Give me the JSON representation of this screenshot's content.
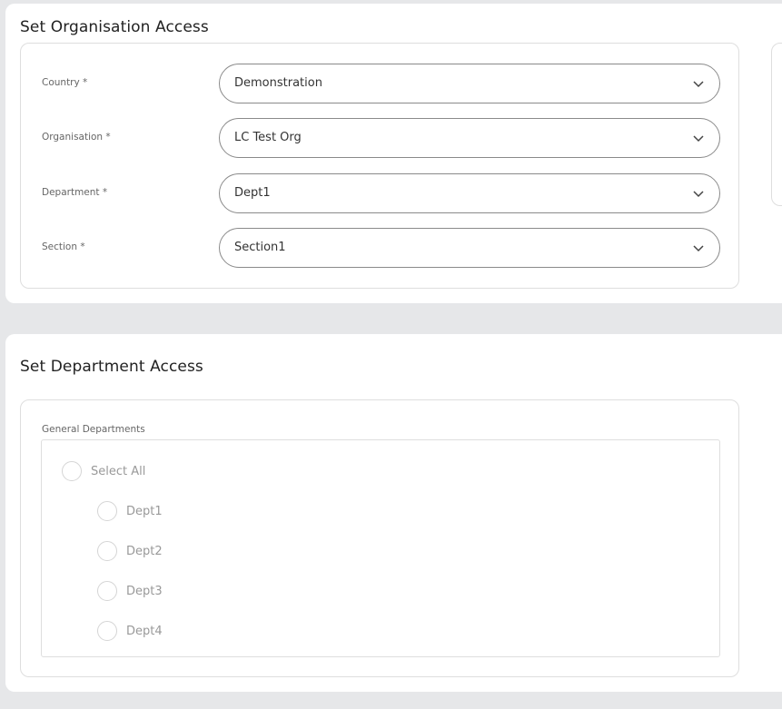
{
  "org_access": {
    "title": "Set Organisation Access",
    "fields": [
      {
        "label": "Country *",
        "value": "Demonstration"
      },
      {
        "label": "Organisation *",
        "value": "LC Test Org"
      },
      {
        "label": "Department *",
        "value": "Dept1"
      },
      {
        "label": "Section *",
        "value": "Section1"
      }
    ]
  },
  "dept_access": {
    "title": "Set Department Access",
    "group_label": "General Departments",
    "select_all": "Select All",
    "departments": [
      "Dept1",
      "Dept2",
      "Dept3",
      "Dept4"
    ]
  }
}
